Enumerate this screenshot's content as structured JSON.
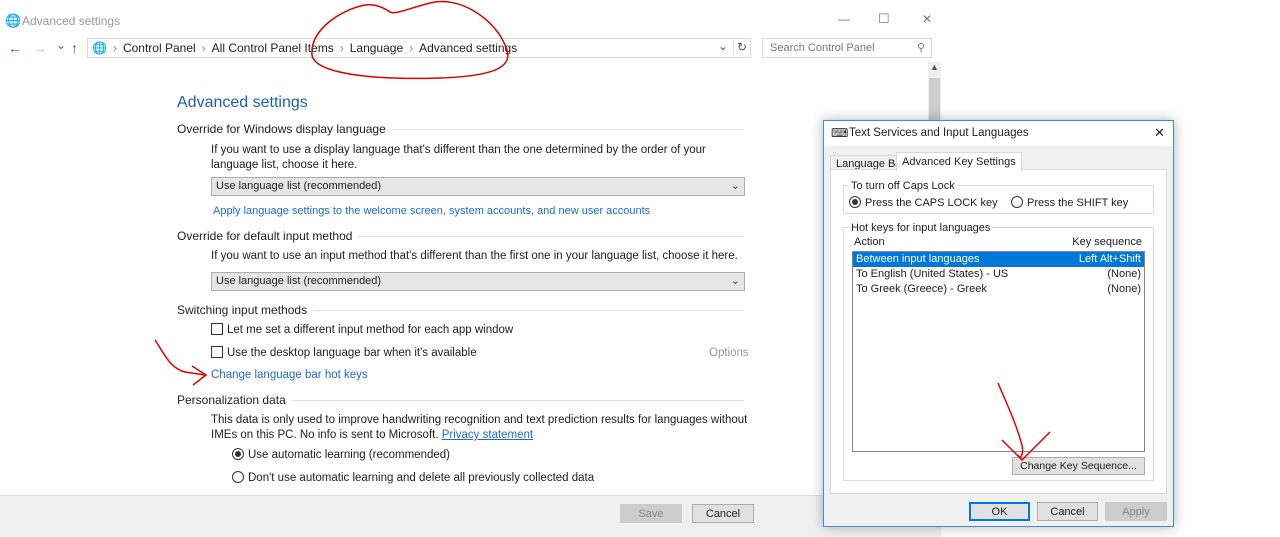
{
  "window": {
    "title": "Advanced settings",
    "minimize": "—",
    "maximize": "☐",
    "close": "✕"
  },
  "nav": {
    "back": "←",
    "forward": "→",
    "recent": "⌄",
    "up": "↑",
    "refresh": "↻",
    "dropdown": "⌄"
  },
  "breadcrumb": [
    "Control Panel",
    "All Control Panel Items",
    "Language",
    "Advanced settings"
  ],
  "search": {
    "placeholder": "Search Control Panel"
  },
  "main": {
    "heading": "Advanced settings",
    "display_lang": {
      "title": "Override for Windows display language",
      "desc": "If you want to use a display language that's different than the one determined by the order of your language list, choose it here.",
      "select": "Use language list (recommended)",
      "link": "Apply language settings to the welcome screen, system accounts, and new user accounts"
    },
    "input_method": {
      "title": "Override for default input method",
      "desc": "If you want to use an input method that's different than the first one in your language list, choose it here.",
      "select": "Use language list (recommended)"
    },
    "switching": {
      "title": "Switching input methods",
      "cb1": "Let me set a different input method for each app window",
      "cb2": "Use the desktop language bar when it's available",
      "options": "Options",
      "link": "Change language bar hot keys"
    },
    "personalization": {
      "title": "Personalization data",
      "desc": "This data is only used to improve handwriting recognition and text prediction results for languages without IMEs on this PC. No info is sent to Microsoft.",
      "privacy": "Privacy statement",
      "r1": "Use automatic learning (recommended)",
      "r2": "Don't use automatic learning and delete all previously collected data"
    },
    "save": "Save",
    "cancel": "Cancel"
  },
  "dialog": {
    "title": "Text Services and Input Languages",
    "close": "✕",
    "tabs": [
      "Language Bar",
      "Advanced Key Settings"
    ],
    "caps": {
      "title": "To turn off Caps Lock",
      "r1": "Press the CAPS LOCK key",
      "r2": "Press the SHIFT key"
    },
    "hotkeys": {
      "title": "Hot keys for input languages",
      "col_action": "Action",
      "col_key": "Key sequence",
      "rows": [
        {
          "action": "Between input languages",
          "key": "Left Alt+Shift"
        },
        {
          "action": "To English (United States) - US",
          "key": "(None)"
        },
        {
          "action": "To Greek (Greece) - Greek",
          "key": "(None)"
        }
      ],
      "change": "Change Key Sequence..."
    },
    "ok": "OK",
    "cancel": "Cancel",
    "apply": "Apply"
  },
  "colors": {
    "accent": "#0078d7",
    "link": "#1e6ad4",
    "annotation": "#e00000"
  }
}
